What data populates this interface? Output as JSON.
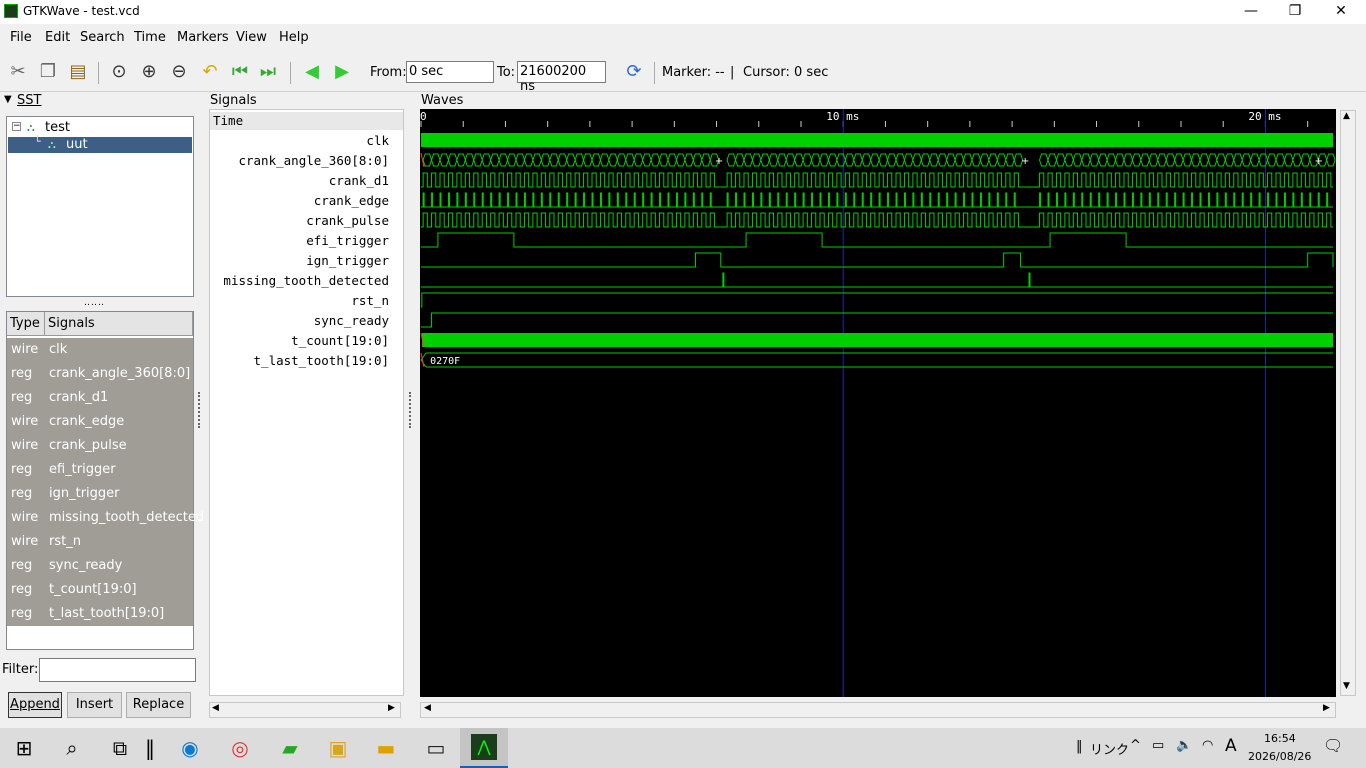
{
  "window": {
    "title": "GTKWave - test.vcd",
    "minimize": "—",
    "restore": "❐",
    "close": "✕"
  },
  "menu": [
    "File",
    "Edit",
    "Search",
    "Time",
    "Markers",
    "View",
    "Help"
  ],
  "toolbar": {
    "from_label": "From:",
    "from_value": "0 sec",
    "to_label": "To:",
    "to_value": "21600200 ns",
    "marker_text": "Marker: --",
    "separator": "|",
    "cursor_text": "Cursor: 0 sec"
  },
  "sst": {
    "label": "SST",
    "tree": [
      {
        "name": "test"
      },
      {
        "name": "uut"
      }
    ],
    "columns": {
      "type": "Type",
      "signals": "Signals"
    },
    "signals": [
      {
        "type": "wire",
        "name": "clk"
      },
      {
        "type": "reg",
        "name": "crank_angle_360[8:0]"
      },
      {
        "type": "reg",
        "name": "crank_d1"
      },
      {
        "type": "wire",
        "name": "crank_edge"
      },
      {
        "type": "wire",
        "name": "crank_pulse"
      },
      {
        "type": "reg",
        "name": "efi_trigger"
      },
      {
        "type": "reg",
        "name": "ign_trigger"
      },
      {
        "type": "wire",
        "name": "missing_tooth_detected"
      },
      {
        "type": "wire",
        "name": "rst_n"
      },
      {
        "type": "reg",
        "name": "sync_ready"
      },
      {
        "type": "reg",
        "name": "t_count[19:0]"
      },
      {
        "type": "reg",
        "name": "t_last_tooth[19:0]"
      }
    ],
    "filter_label": "Filter:",
    "filter_value": "",
    "buttons": {
      "append": "Append",
      "insert": "Insert",
      "replace": "Replace"
    }
  },
  "signals_panel": {
    "label": "Signals",
    "time_header": "Time",
    "names": [
      "clk",
      "crank_angle_360[8:0]",
      "crank_d1",
      "crank_edge",
      "crank_pulse",
      "efi_trigger",
      "ign_trigger",
      "missing_tooth_detected",
      "rst_n",
      "sync_ready",
      "t_count[19:0]",
      "t_last_tooth[19:0]"
    ]
  },
  "waves_panel": {
    "label": "Waves",
    "ruler": [
      {
        "text": "0",
        "t_ms": 0
      },
      {
        "text": "10 ms",
        "t_ms": 10
      },
      {
        "text": "20 ms",
        "t_ms": 20
      }
    ],
    "visible_span_ms": 21.6002,
    "t_last_tooth_value": "0270F",
    "efi_trigger_high_ms": [
      [
        0.4,
        2.2
      ],
      [
        7.7,
        9.5
      ],
      [
        14.9,
        16.7
      ]
    ],
    "ign_trigger_high_ms": [
      [
        6.5,
        7.1
      ],
      [
        13.8,
        14.2
      ],
      [
        21.0,
        21.6
      ]
    ],
    "missing_tooth_ms": [
      7.15,
      14.4
    ],
    "sync_ready_rise_ms": 0.25
  },
  "taskbar": {
    "link_label": "リンク",
    "ime": "A",
    "time": "16:54",
    "date": "2026/08/26"
  },
  "colors": {
    "wave_green": "#00d000",
    "wave_bg": "#000000",
    "grid_blue": "#2424a8",
    "sig_row_bg": "#a09d96"
  }
}
